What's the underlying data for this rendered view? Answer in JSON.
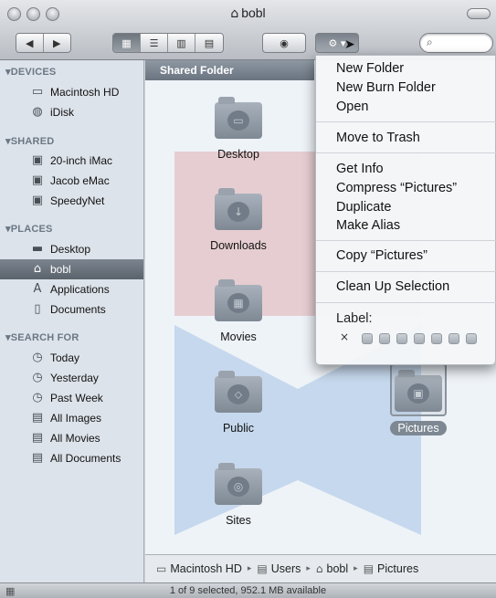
{
  "window": {
    "title": "bobl",
    "title_icon": "home-icon"
  },
  "toolbar": {
    "back_icon": "back-arrow-icon",
    "forward_icon": "forward-arrow-icon",
    "view_modes": [
      "icon-view-icon",
      "list-view-icon",
      "column-view-icon",
      "coverflow-view-icon"
    ],
    "quicklook_icon": "eye-icon",
    "action_icon": "gear-icon",
    "search": {
      "value": "",
      "placeholder": ""
    }
  },
  "sidebar": {
    "sections": [
      {
        "title": "DEVICES",
        "items": [
          {
            "label": "Macintosh HD",
            "icon": "hard-drive-icon"
          },
          {
            "label": "iDisk",
            "icon": "idisk-icon"
          }
        ]
      },
      {
        "title": "SHARED",
        "items": [
          {
            "label": "20-inch iMac",
            "icon": "computer-icon"
          },
          {
            "label": "Jacob eMac",
            "icon": "computer-icon"
          },
          {
            "label": "SpeedyNet",
            "icon": "computer-icon"
          }
        ]
      },
      {
        "title": "PLACES",
        "items": [
          {
            "label": "Desktop",
            "icon": "desktop-icon"
          },
          {
            "label": "bobl",
            "icon": "home-icon",
            "selected": true
          },
          {
            "label": "Applications",
            "icon": "applications-icon"
          },
          {
            "label": "Documents",
            "icon": "document-icon"
          }
        ]
      },
      {
        "title": "SEARCH FOR",
        "items": [
          {
            "label": "Today",
            "icon": "clock-icon"
          },
          {
            "label": "Yesterday",
            "icon": "clock-icon"
          },
          {
            "label": "Past Week",
            "icon": "clock-icon"
          },
          {
            "label": "All Images",
            "icon": "smart-folder-icon"
          },
          {
            "label": "All Movies",
            "icon": "smart-folder-icon"
          },
          {
            "label": "All Documents",
            "icon": "smart-folder-icon"
          }
        ]
      }
    ]
  },
  "main": {
    "column_header": "Shared Folder",
    "folders": [
      {
        "label": "Desktop",
        "icon": "desktop-folder-icon"
      },
      {
        "label": "Downloads",
        "icon": "downloads-folder-icon"
      },
      {
        "label": "Movies",
        "icon": "movies-folder-icon"
      },
      {
        "label": "Public",
        "icon": "public-folder-icon"
      },
      {
        "label": "Sites",
        "icon": "sites-folder-icon"
      },
      {
        "label": "Pictures",
        "icon": "pictures-folder-icon",
        "selected": true
      }
    ]
  },
  "context_menu": {
    "groups": [
      [
        "New Folder",
        "New Burn Folder",
        "Open"
      ],
      [
        "Move to Trash"
      ],
      [
        "Get Info",
        "Compress “Pictures”",
        "Duplicate",
        "Make Alias"
      ],
      [
        "Copy “Pictures”"
      ],
      [
        "Clean Up Selection"
      ]
    ],
    "label_title": "Label:",
    "label_clear": "×",
    "label_swatch_count": 7
  },
  "pathbar": {
    "segments": [
      "Macintosh HD",
      "Users",
      "bobl",
      "Pictures"
    ],
    "separator": "▸"
  },
  "status": {
    "text": "1 of 9 selected, 952.1 MB available"
  },
  "colors": {
    "sidebar_bg": "#dde3ea",
    "selection": "#6a737d",
    "menu_bg": "#f4f6f8"
  }
}
